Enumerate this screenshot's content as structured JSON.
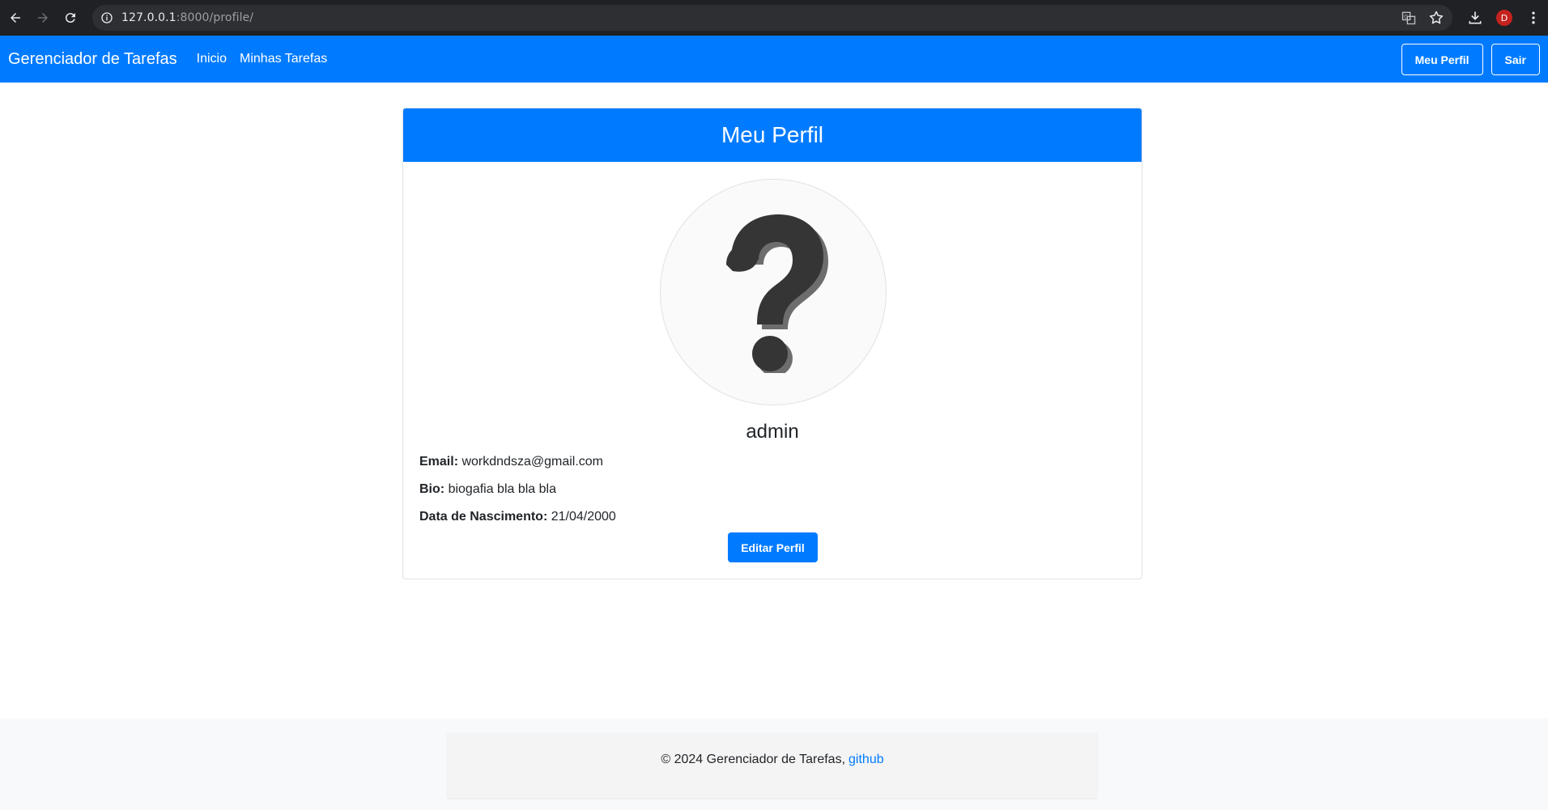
{
  "browser": {
    "url_host": "127.0.0.1",
    "url_rest": ":8000/profile/",
    "profile_initial": "D"
  },
  "navbar": {
    "brand": "Gerenciador de Tarefas",
    "links": [
      "Inicio",
      "Minhas Tarefas"
    ],
    "profile_button": "Meu Perfil",
    "logout_button": "Sair"
  },
  "card": {
    "title": "Meu Perfil",
    "username": "admin",
    "email_label": "Email:",
    "email": "workdndsza@gmail.com",
    "bio_label": "Bio:",
    "bio": "biogafia bla bla bla",
    "birth_label": "Data de Nascimento:",
    "birth": "21/04/2000",
    "edit_button": "Editar Perfil"
  },
  "footer": {
    "text": "© 2024 Gerenciador de Tarefas,",
    "link": "github"
  },
  "colors": {
    "primary": "#007bff",
    "chrome_bg": "#202124"
  }
}
